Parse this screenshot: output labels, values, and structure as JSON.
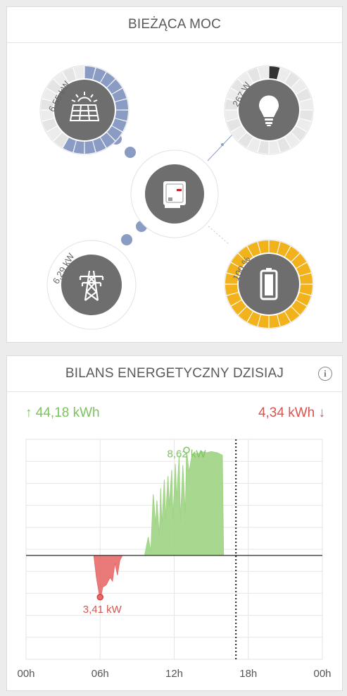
{
  "power": {
    "title": "BIEŻĄCA MOC",
    "solar": {
      "value": "6,55 kW",
      "icon": "solar-panel-icon",
      "fill": 0.6
    },
    "consumption": {
      "value": "267 W",
      "icon": "lightbulb-icon",
      "fill": 0.04
    },
    "grid": {
      "value": "6,29 kW",
      "icon": "power-pylon-icon"
    },
    "battery": {
      "value": "100 %",
      "icon": "battery-icon",
      "fill": 1.0
    },
    "inverter": {
      "icon": "inverter-icon"
    },
    "colors": {
      "solar": "#8a9bc4",
      "battery": "#f2b21b",
      "consumption": "#333333",
      "node": "#707070"
    }
  },
  "balance": {
    "title": "BILANS ENERGETYCZNY DZISIAJ",
    "produced": "↑ 44,18 kWh",
    "consumed": "4,34 kWh ↓",
    "peak_label": "8,62 kW",
    "low_label": "3,41 kW"
  },
  "chart_data": {
    "type": "area",
    "x_ticks": [
      "00h",
      "06h",
      "12h",
      "18h",
      "00h"
    ],
    "xlim": [
      0,
      24
    ],
    "ylim": [
      -8.5,
      9.5
    ],
    "current_time": 17,
    "series": [
      {
        "name": "production",
        "color": "#9fd484",
        "x": [
          9.6,
          9.9,
          10.1,
          10.3,
          10.5,
          10.6,
          10.8,
          10.9,
          11.0,
          11.2,
          11.3,
          11.5,
          11.6,
          11.8,
          11.9,
          12.1,
          12.2,
          12.4,
          12.5,
          12.7,
          12.9,
          13.0,
          13.2,
          13.4,
          13.6,
          13.9,
          14.2,
          14.6,
          15.0,
          15.5,
          15.9,
          16.0
        ],
        "y": [
          0,
          1.5,
          0.3,
          5.0,
          2.5,
          4.5,
          1.5,
          5.5,
          2.5,
          6.2,
          3.0,
          6.5,
          4.0,
          7.0,
          3.0,
          7.5,
          4.5,
          8.2,
          2.8,
          7.4,
          3.4,
          8.62,
          6.8,
          8.0,
          8.4,
          8.3,
          8.5,
          8.4,
          8.5,
          8.4,
          8.2,
          0
        ]
      },
      {
        "name": "consumption",
        "color": "#e86a6a",
        "x": [
          5.5,
          5.7,
          5.9,
          6.0,
          6.1,
          6.2,
          6.5,
          6.8,
          7.0,
          7.2,
          7.4,
          7.6,
          7.8
        ],
        "y": [
          -0.1,
          -1.8,
          -3.0,
          -3.41,
          -3.2,
          -2.6,
          -2.4,
          -1.8,
          -2.1,
          -0.6,
          -1.6,
          -0.4,
          0
        ]
      }
    ]
  }
}
